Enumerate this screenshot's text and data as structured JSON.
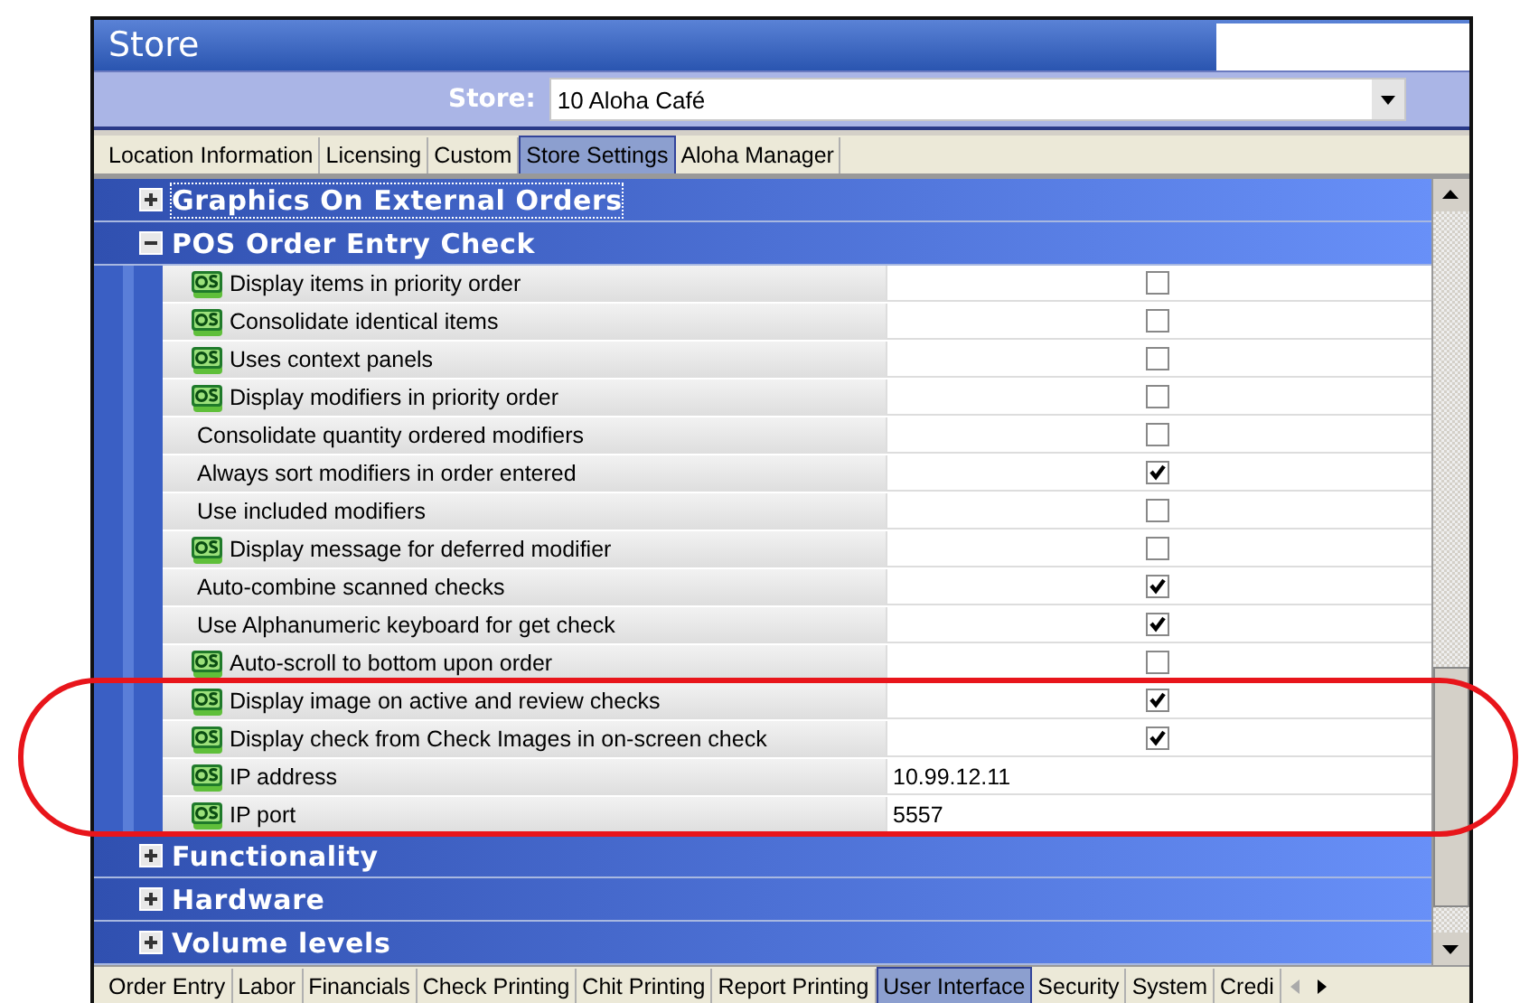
{
  "window": {
    "title": "Store"
  },
  "store_selector": {
    "label": "Store:",
    "value": "10 Aloha Café"
  },
  "top_tabs": [
    {
      "label": "Location Information",
      "selected": false
    },
    {
      "label": "Licensing",
      "selected": false
    },
    {
      "label": "Custom",
      "selected": false
    },
    {
      "label": "Store Settings",
      "selected": true
    },
    {
      "label": "Aloha Manager",
      "selected": false
    }
  ],
  "groups": [
    {
      "title": "Graphics On External Orders",
      "expanded": false,
      "focused": true
    },
    {
      "title": "POS Order Entry Check",
      "expanded": true,
      "focused": false,
      "items": [
        {
          "label": "Display items in priority order",
          "qs": true,
          "kind": "checkbox",
          "checked": false
        },
        {
          "label": "Consolidate identical items",
          "qs": true,
          "kind": "checkbox",
          "checked": false
        },
        {
          "label": "Uses context panels",
          "qs": true,
          "kind": "checkbox",
          "checked": false
        },
        {
          "label": "Display modifiers in priority order",
          "qs": true,
          "kind": "checkbox",
          "checked": false
        },
        {
          "label": "Consolidate quantity ordered modifiers",
          "qs": false,
          "kind": "checkbox",
          "checked": false
        },
        {
          "label": "Always sort modifiers in order entered",
          "qs": false,
          "kind": "checkbox",
          "checked": true
        },
        {
          "label": "Use included modifiers",
          "qs": false,
          "kind": "checkbox",
          "checked": false
        },
        {
          "label": "Display message for deferred modifier",
          "qs": true,
          "kind": "checkbox",
          "checked": false
        },
        {
          "label": "Auto-combine scanned checks",
          "qs": false,
          "kind": "checkbox",
          "checked": true
        },
        {
          "label": "Use Alphanumeric keyboard for get check",
          "qs": false,
          "kind": "checkbox",
          "checked": true
        },
        {
          "label": "Auto-scroll to bottom upon order",
          "qs": true,
          "kind": "checkbox",
          "checked": false
        },
        {
          "label": "Display image on active and review checks",
          "qs": true,
          "kind": "checkbox",
          "checked": true
        },
        {
          "label": "Display check from Check Images in on-screen check",
          "qs": true,
          "kind": "checkbox",
          "checked": true
        },
        {
          "label": "IP address",
          "qs": true,
          "kind": "text",
          "value": "10.99.12.11"
        },
        {
          "label": "IP port",
          "qs": true,
          "kind": "text",
          "value": "5557"
        }
      ]
    },
    {
      "title": "Functionality",
      "expanded": false,
      "focused": false
    },
    {
      "title": "Hardware",
      "expanded": false,
      "focused": false
    },
    {
      "title": "Volume levels",
      "expanded": false,
      "focused": false
    }
  ],
  "bottom_tabs": [
    {
      "label": "Order Entry",
      "selected": false
    },
    {
      "label": "Labor",
      "selected": false
    },
    {
      "label": "Financials",
      "selected": false
    },
    {
      "label": "Check Printing",
      "selected": false
    },
    {
      "label": "Chit Printing",
      "selected": false
    },
    {
      "label": "Report Printing",
      "selected": false
    },
    {
      "label": "User Interface",
      "selected": true
    },
    {
      "label": "Security",
      "selected": false
    },
    {
      "label": "System",
      "selected": false
    },
    {
      "label": "Credi",
      "selected": false
    }
  ],
  "tab_scroll": {
    "left_disabled": true,
    "right_disabled": false
  }
}
